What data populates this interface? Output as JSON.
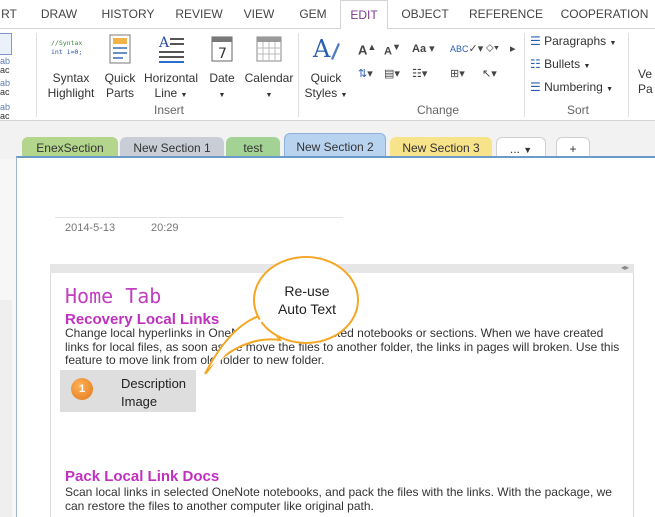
{
  "ribbon_tabs": [
    {
      "label": "RT"
    },
    {
      "label": "DRAW"
    },
    {
      "label": "HISTORY"
    },
    {
      "label": "REVIEW"
    },
    {
      "label": "VIEW"
    },
    {
      "label": "GEM"
    },
    {
      "label": "EDIT"
    },
    {
      "label": "OBJECT"
    },
    {
      "label": "REFERENCE"
    },
    {
      "label": "COOPERATION"
    }
  ],
  "active_tab": "EDIT",
  "ribbon": {
    "insert_group": {
      "label": "Insert",
      "syntax_highlight": {
        "line1": "Syntax",
        "line2": "Highlight",
        "icon_line1": "//Syntax",
        "icon_line2": "int i=0;"
      },
      "quick_parts": {
        "line1": "Quick",
        "line2": "Parts"
      },
      "horizontal_line": {
        "line1": "Horizontal",
        "line2": "Line"
      },
      "date": {
        "line1": "Date",
        "icon_text": "7"
      },
      "calendar": {
        "line1": "Calendar"
      }
    },
    "quick_styles": {
      "line1": "Quick",
      "line2": "Styles"
    },
    "change_group": {
      "label": "Change"
    },
    "sort_group": {
      "label": "Sort",
      "paragraphs": "Paragraphs",
      "bullets": "Bullets",
      "numbering": "Numbering"
    },
    "cut_off": {
      "line1": "Ve",
      "line2": "Pa"
    }
  },
  "sections": [
    {
      "label": "EnexSection",
      "color": "#b3d58c"
    },
    {
      "label": "New Section 1",
      "color": "#c9ced6"
    },
    {
      "label": "test",
      "color": "#a3d394"
    },
    {
      "label": "New Section 2",
      "color": "#b8d3ef"
    },
    {
      "label": "New Section 3",
      "color": "#f7e38a"
    }
  ],
  "section_more": "...",
  "add_section": "+",
  "page": {
    "date": "2014-5-13",
    "time": "20:29",
    "title": "Home Tab",
    "heading1": "Recovery Local Links",
    "para1_lines": [
      "Change local hyperlinks in OneNote pages of selected notebooks or sections. When we have created",
      "links for local files, as soon as we move the files to another folder, the links in pages will broken. Use this",
      "feature to move link from old folder to new folder."
    ],
    "description": {
      "number": "1",
      "line1": "Description",
      "line2": "Image"
    },
    "heading2": "Pack Local Link Docs",
    "para2_lines": [
      "Scan local links in selected OneNote notebooks, and pack the files with the links. With the package, we",
      "can restore the files to another computer like original path."
    ]
  },
  "callout": {
    "line1": "Re-use",
    "line2": "Auto Text",
    "color": "#f5a623"
  }
}
